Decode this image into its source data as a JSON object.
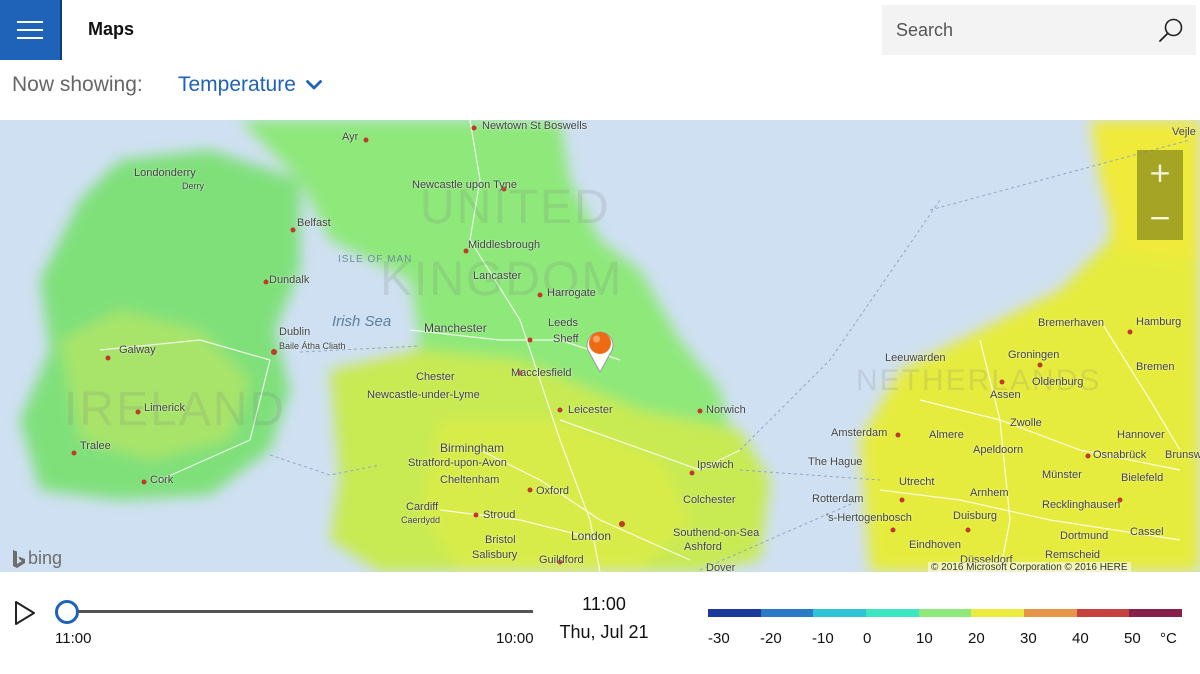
{
  "app": {
    "title": "Maps"
  },
  "search": {
    "placeholder": "Search"
  },
  "layer": {
    "now_showing_label": "Now showing:",
    "selected": "Temperature"
  },
  "map": {
    "places": {
      "newtown": "Newtown St Boswells",
      "ayr": "Ayr",
      "londonderry": "Londonderry",
      "derry": "Derry",
      "newcastle": "Newcastle upon Tyne",
      "belfast": "Belfast",
      "isle_of_man": "ISLE OF MAN",
      "middlesbrough": "Middlesbrough",
      "dundalk": "Dundalk",
      "lancaster": "Lancaster",
      "harrogate": "Harrogate",
      "irish_sea": "Irish Sea",
      "manchester": "Manchester",
      "leeds": "Leeds",
      "sheffield": "Sheff",
      "dublin": "Dublin",
      "baile": "Baile Átha Cliath",
      "galway": "Galway",
      "chester": "Chester",
      "macclesfield": "Macclesfield",
      "newcastle_lyme": "Newcastle-under-Lyme",
      "limerick": "Limerick",
      "leicester": "Leicester",
      "norwich": "Norwich",
      "tralee": "Tralee",
      "birmingham": "Birmingham",
      "stratford": "Stratford-upon-Avon",
      "ipswich": "Ipswich",
      "cork": "Cork",
      "cheltenham": "Cheltenham",
      "oxford": "Oxford",
      "colchester": "Colchester",
      "cardiff": "Cardiff",
      "caerdydd": "Caerdydd",
      "stroud": "Stroud",
      "bristol": "Bristol",
      "london": "London",
      "southend": "Southend-on-Sea",
      "ashford": "Ashford",
      "salisbury": "Salisbury",
      "guildford": "Guildford",
      "dover": "Dover",
      "leeuwarden": "Leeuwarden",
      "groningen": "Groningen",
      "bremerhaven": "Bremerhaven",
      "hamburg": "Hamburg",
      "bremen": "Bremen",
      "oldenburg": "Oldenburg",
      "assen": "Assen",
      "zwolle": "Zwolle",
      "amsterdam": "Amsterdam",
      "almere": "Almere",
      "hannover": "Hannover",
      "the_hague": "The Hague",
      "apeldoorn": "Apeldoorn",
      "osnabruck": "Osnabrück",
      "brunsw": "Brunsw",
      "utrecht": "Utrecht",
      "munster": "Münster",
      "bielefeld": "Bielefeld",
      "rotterdam": "Rotterdam",
      "arnhem": "Arnhem",
      "hertogenbosch": "'s-Hertogenbosch",
      "duisburg": "Duisburg",
      "recklinghausen": "Recklinghausen",
      "eindhoven": "Eindhoven",
      "dortmund": "Dortmund",
      "kassel": "Cassel",
      "remscheid": "Remscheid",
      "dusseldorf": "Düsseldorf",
      "vejle": "Vejle"
    },
    "countries": {
      "uk_line1": "UNITED",
      "uk_line2": "KINGDOM",
      "ireland": "IRELAND",
      "netherlands": "NETHERLANDS"
    },
    "zoom_in": "+",
    "zoom_out": "−",
    "bing_label": "bing",
    "copyright": "© 2016 Microsoft Corporation    © 2016 HERE"
  },
  "timeline": {
    "start_label": "11:00",
    "end_label": "10:00",
    "current_time": "11:00",
    "current_date": "Thu, Jul 21",
    "position": 0.0
  },
  "legend": {
    "colors": [
      "#1b3a9c",
      "#2a7bc6",
      "#2fc3d8",
      "#3be6c0",
      "#8ee87a",
      "#ecec3e",
      "#e8954a",
      "#c6403f",
      "#86204a"
    ],
    "labels": [
      "-30",
      "-20",
      "-10",
      "0",
      "10",
      "20",
      "30",
      "40",
      "50",
      "°C"
    ]
  },
  "icons": {
    "menu": "hamburger-icon",
    "search": "search-icon",
    "chevron": "chevron-down-icon",
    "play": "play-icon",
    "pin": "location-pin-icon"
  }
}
